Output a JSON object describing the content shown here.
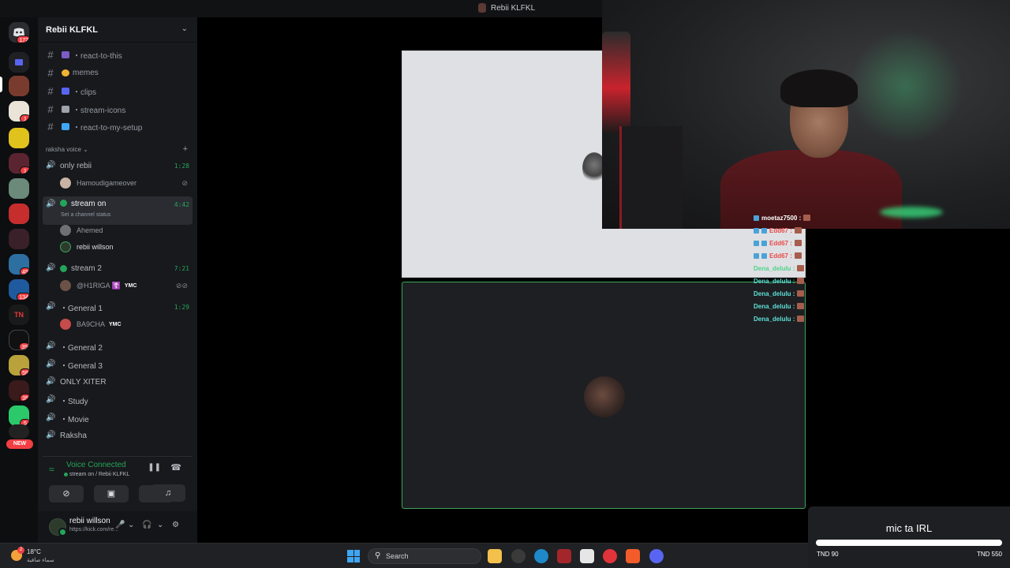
{
  "window": {
    "title": "Rebii KLFKL"
  },
  "rail": {
    "home_badge": "172",
    "servers": [
      {
        "badge": ""
      },
      {
        "badge": ""
      },
      {
        "badge": "1"
      },
      {
        "badge": "1"
      },
      {
        "badge": ""
      },
      {
        "badge": "1"
      },
      {
        "badge": ""
      },
      {
        "badge": ""
      },
      {
        "badge": ""
      },
      {
        "badge": "45"
      },
      {
        "badge": "134"
      },
      {
        "badge": ""
      },
      {
        "badge": "39"
      },
      {
        "badge": "55"
      },
      {
        "badge": "35"
      },
      {
        "badge": "5"
      },
      {
        "badge": ""
      }
    ],
    "new_label": "NEW"
  },
  "sidebar": {
    "server_name": "Rebii KLFKL",
    "text_channels": [
      {
        "name": "・react-to-this",
        "emoji_color": "#7b5cc7"
      },
      {
        "name": "memes",
        "emoji_color": "#f0b232"
      },
      {
        "name": "・clips",
        "emoji_color": "#5865f2"
      },
      {
        "name": "・stream-icons",
        "emoji_color": "#9fa3ab"
      },
      {
        "name": "・react-to-my-setup",
        "emoji_color": "#3fa6f3"
      }
    ],
    "category": "raksha voice",
    "voice_channels": {
      "only_rebii": {
        "name": "only rebii",
        "time": "1:28",
        "users": [
          {
            "name": "Hamoudigameover"
          }
        ]
      },
      "stream_on": {
        "name": "stream on",
        "time": "4:42",
        "status": "Set a channel status",
        "users": [
          {
            "name": "Ahemed"
          },
          {
            "name": "rebii willson"
          }
        ]
      },
      "stream_2": {
        "name": "stream 2",
        "time": "7:21",
        "users": [
          {
            "name": "@H1RIGA ☦️",
            "tag": "YMC"
          }
        ]
      },
      "general_1": {
        "name": "・General 1",
        "time": "1:29",
        "users": [
          {
            "name": "BA9CHA",
            "tag": "YMC"
          }
        ]
      },
      "others": [
        {
          "name": "・General 2"
        },
        {
          "name": "・General 3"
        },
        {
          "name": "ONLY XITER"
        },
        {
          "name": "・Study"
        },
        {
          "name": "・Movie"
        },
        {
          "name": "Raksha"
        }
      ]
    }
  },
  "voice_panel": {
    "status": "Voice Connected",
    "sub": "stream on / Rebii KLFKL"
  },
  "user_panel": {
    "name": "rebii willson",
    "sub": "https://kick.com/re..."
  },
  "chat": [
    {
      "user": "moetaz7500 :",
      "color": "white"
    },
    {
      "user": "Edd67 :",
      "color": "red"
    },
    {
      "user": "Edd67 :",
      "color": "red"
    },
    {
      "user": "Edd67 :",
      "color": "red"
    },
    {
      "user": "Dena_delulu :",
      "color": "green"
    },
    {
      "user": "Dena_delulu :",
      "color": "cyan"
    },
    {
      "user": "Dena_delulu :",
      "color": "cyan"
    },
    {
      "user": "Dena_delulu :",
      "color": "cyan"
    },
    {
      "user": "Dena_delulu :",
      "color": "cyan"
    }
  ],
  "goal": {
    "title": "mic ta IRL",
    "min_label": "TND 90",
    "max_label": "TND 550",
    "progress_fraction": 1.0
  },
  "taskbar": {
    "weather_badge": "2",
    "temp": "18°C",
    "weather_desc": "سماء صافية",
    "search_placeholder": "Search"
  }
}
